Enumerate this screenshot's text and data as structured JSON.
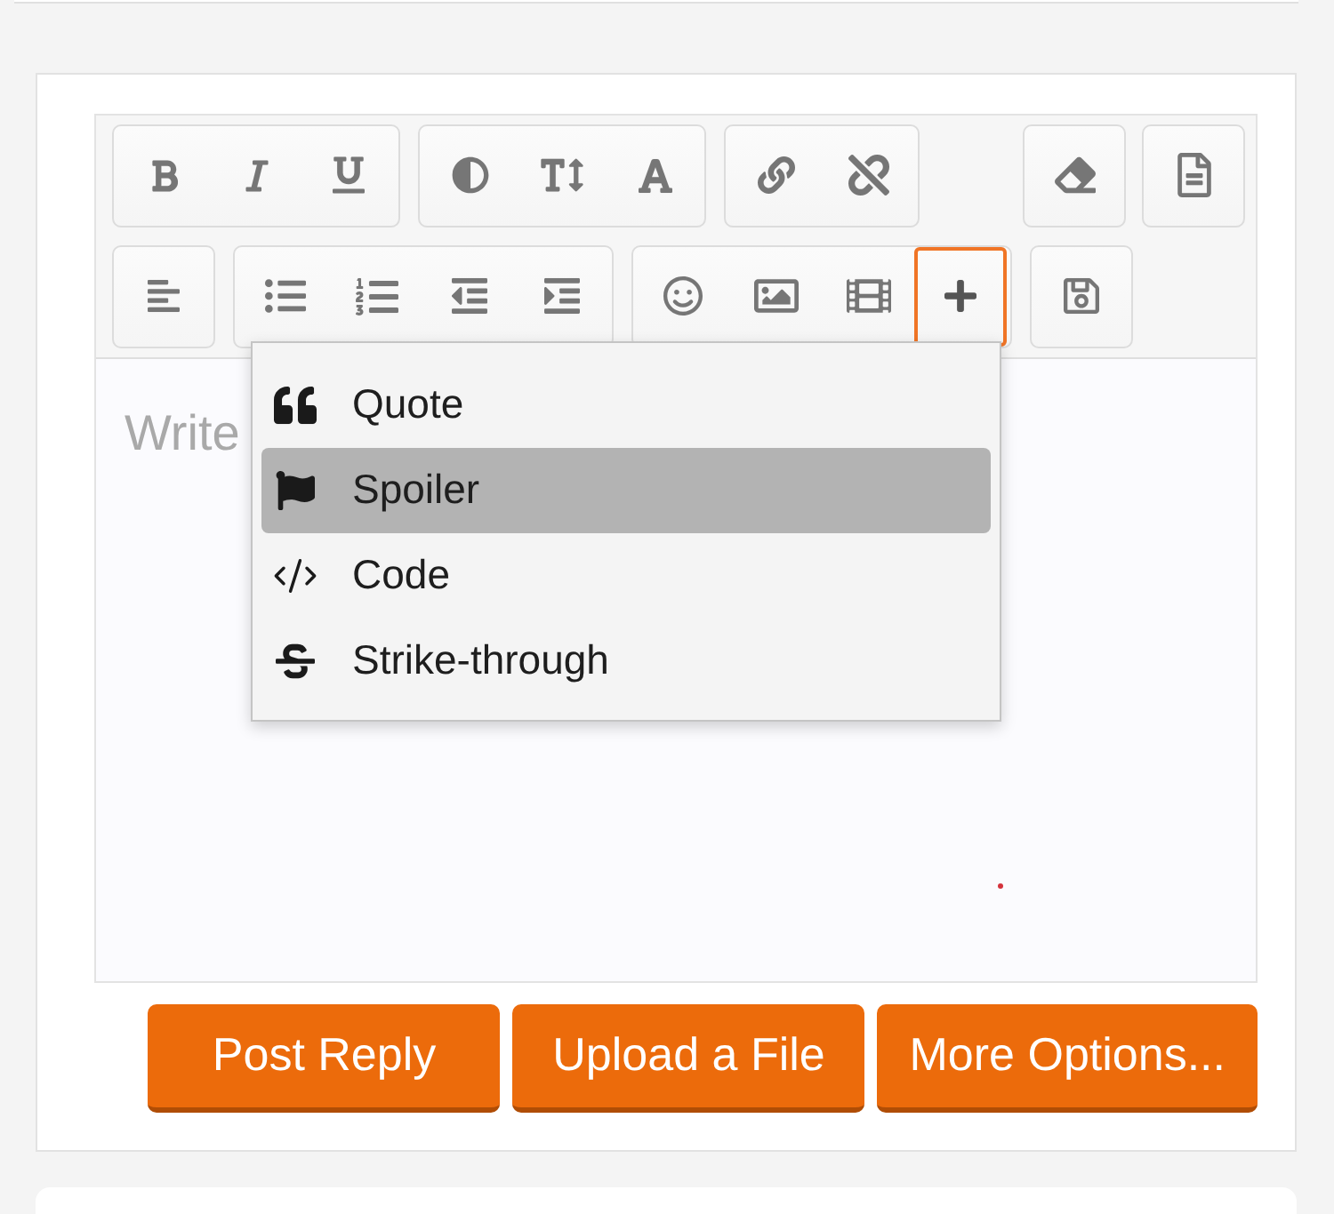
{
  "toolbar": {
    "rows": [
      {
        "groups": [
          {
            "buttons": [
              {
                "kind": "bold",
                "highlighted": false
              },
              {
                "kind": "italic",
                "highlighted": false
              },
              {
                "kind": "underline",
                "highlighted": false
              }
            ]
          },
          {
            "buttons": [
              {
                "kind": "contrast",
                "highlighted": false
              },
              {
                "kind": "size",
                "highlighted": false
              },
              {
                "kind": "font",
                "highlighted": false
              }
            ]
          },
          {
            "buttons": [
              {
                "kind": "link",
                "highlighted": false
              },
              {
                "kind": "unlink",
                "highlighted": false
              }
            ]
          }
        ],
        "end_groups": [
          {
            "buttons": [
              {
                "kind": "eraser",
                "highlighted": false
              }
            ]
          },
          {
            "buttons": [
              {
                "kind": "document",
                "highlighted": false
              }
            ]
          }
        ]
      },
      {
        "groups": [
          {
            "buttons": [
              {
                "kind": "align",
                "highlighted": false
              }
            ]
          },
          {
            "buttons": [
              {
                "kind": "bullets",
                "highlighted": false
              },
              {
                "kind": "numbers",
                "highlighted": false
              },
              {
                "kind": "outdent",
                "highlighted": false
              },
              {
                "kind": "indent",
                "highlighted": false
              }
            ]
          },
          {
            "buttons": [
              {
                "kind": "smiley",
                "highlighted": false
              },
              {
                "kind": "image",
                "highlighted": false
              },
              {
                "kind": "film",
                "highlighted": false
              },
              {
                "kind": "plus",
                "highlighted": true
              }
            ]
          },
          {
            "buttons": [
              {
                "kind": "save",
                "highlighted": false
              }
            ]
          }
        ]
      }
    ]
  },
  "editor": {
    "placeholder": "Write"
  },
  "menu": {
    "items": [
      {
        "kind": "quote",
        "label": "Quote",
        "selected": false
      },
      {
        "kind": "flag",
        "label": "Spoiler",
        "selected": true
      },
      {
        "kind": "code",
        "label": "Code",
        "selected": false
      },
      {
        "kind": "strike",
        "label": "Strike-through",
        "selected": false
      }
    ]
  },
  "actions": [
    "Post Reply",
    "Upload a File",
    "More Options..."
  ]
}
